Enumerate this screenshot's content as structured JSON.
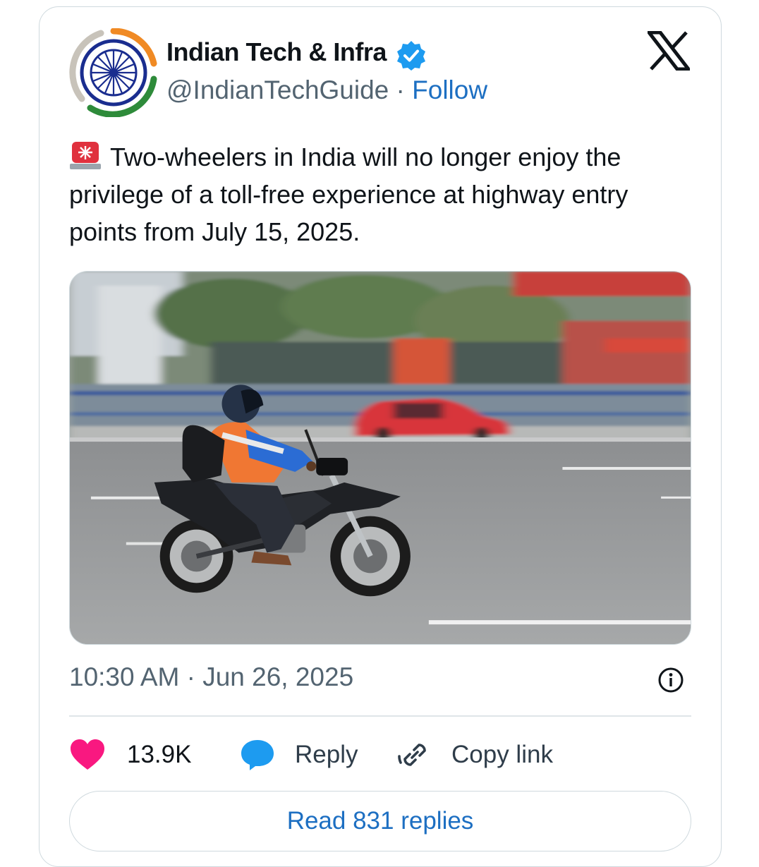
{
  "author": {
    "name": "Indian Tech & Infra",
    "handle": "@IndianTechGuide",
    "separator": "·",
    "follow_label": "Follow"
  },
  "tweet": {
    "text": "Two-wheelers in India will no longer enjoy the privilege of a toll-free experience at highway entry points from July 15, 2025.",
    "emoji_icon": "police-siren-icon",
    "timestamp": "10:30 AM · Jun 26, 2025"
  },
  "actions": {
    "likes": "13.9K",
    "reply_label": "Reply",
    "copy_label": "Copy link"
  },
  "read_replies_label": "Read 831 replies",
  "colors": {
    "accent_blue": "#1d6fc2",
    "like_pink": "#f91880",
    "reply_blue": "#1d9bf0",
    "text_secondary": "#536471"
  }
}
